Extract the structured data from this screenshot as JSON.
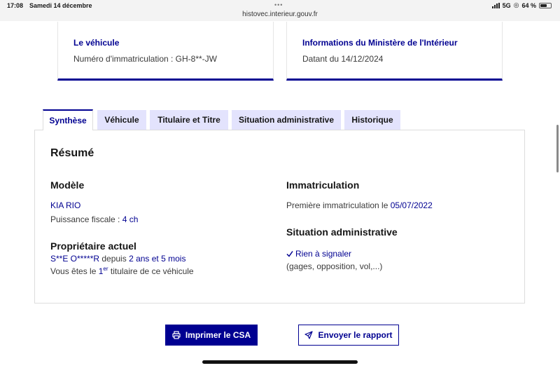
{
  "status_bar": {
    "time": "17:08",
    "date": "Samedi 14 décembre",
    "url": "histovec.interieur.gouv.fr",
    "network": "5G",
    "battery": "64 %",
    "battery_level": 0.64
  },
  "cards": {
    "vehicle": {
      "title": "Le véhicule",
      "text": "Numéro d'immatriculation : GH-8**-JW"
    },
    "ministry": {
      "title": "Informations du Ministère de l'Intérieur",
      "text": "Datant du 14/12/2024"
    }
  },
  "tabs": [
    {
      "label": "Synthèse",
      "active": true
    },
    {
      "label": "Véhicule",
      "active": false
    },
    {
      "label": "Titulaire et Titre",
      "active": false
    },
    {
      "label": "Situation administrative",
      "active": false
    },
    {
      "label": "Historique",
      "active": false
    }
  ],
  "summary": {
    "title": "Résumé",
    "model": {
      "heading": "Modèle",
      "name": "KIA RIO",
      "power_label": "Puissance fiscale : ",
      "power_value": "4 ch"
    },
    "owner": {
      "heading": "Propriétaire actuel",
      "name": "S**E O*****R",
      "since_label": " depuis ",
      "duration": "2 ans et 5 mois",
      "rank_prefix": "Vous êtes le ",
      "rank_number": "1",
      "rank_suffix": "er",
      "rank_text": " titulaire de ce véhicule"
    },
    "registration": {
      "heading": "Immatriculation",
      "label": "Première immatriculation le ",
      "date": "05/07/2022"
    },
    "admin": {
      "heading": "Situation administrative",
      "status": "Rien à signaler",
      "details": "(gages, opposition, vol,...)"
    }
  },
  "actions": {
    "print_label": "Imprimer le CSA",
    "send_label": "Envoyer le rapport"
  },
  "colors": {
    "primary": "#000091",
    "tab_inactive": "#e3e3fd"
  },
  "icons": {
    "print": "printer-icon",
    "send": "send-icon",
    "check": "check-icon"
  }
}
